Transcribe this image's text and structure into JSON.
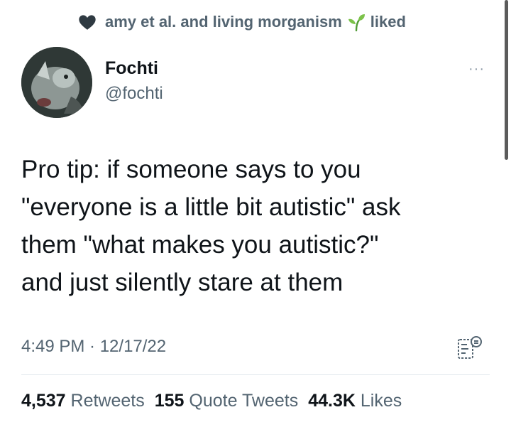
{
  "context": {
    "liked_by": "amy et al. and living morganism",
    "suffix": "liked"
  },
  "author": {
    "name": "Fochti",
    "handle": "@fochti",
    "more": "···"
  },
  "tweet": {
    "text": "Pro tip: if someone says to you\n\"everyone is a little bit autistic\" ask\nthem \"what makes you autistic?\"\nand just silently stare at them",
    "timestamp": "4:49 PM · 12/17/22"
  },
  "stats": {
    "retweets_count": "4,537",
    "retweets_label": "Retweets",
    "quotes_count": "155",
    "quotes_label": "Quote Tweets",
    "likes_count": "44.3K",
    "likes_label": "Likes"
  },
  "colors": {
    "primary_text": "#0f1419",
    "secondary_text": "#536471",
    "sprout": "#7cc24a"
  },
  "icons": {
    "heart": "heart-icon",
    "sprout": "sprout-icon",
    "more": "more-icon",
    "translate": "translate-icon"
  }
}
